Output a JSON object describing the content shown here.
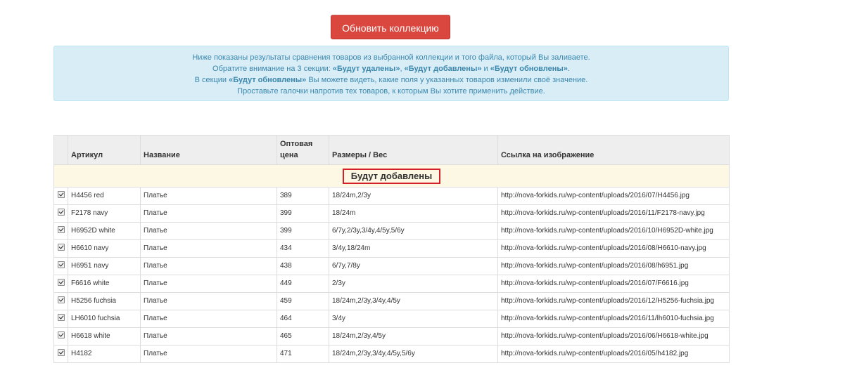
{
  "update_button": {
    "label": "Обновить коллекцию"
  },
  "info": {
    "line1": "Ниже показаны результаты сравнения товаров из выбранной коллекции и того файла, который Вы заливаете.",
    "line2_prefix": "Обратите внимание на 3 секции: ",
    "line2_s1": "«Будут удалены»",
    "line2_sep1": ", ",
    "line2_s2": "«Будут добавлены»",
    "line2_sep2": " и ",
    "line2_s3": "«Будут обновлены»",
    "line2_suffix": ".",
    "line3_prefix": "В секции ",
    "line3_bold": "«Будут обновлены»",
    "line3_suffix": " Вы можете видеть, какие поля у указанных товаров изменили своё значение.",
    "line4": "Проставьте галочки напротив тех товаров, к которым Вы хотите применить действие."
  },
  "table": {
    "headers": [
      "",
      "Артикул",
      "Название",
      "Оптовая цена",
      "Размеры / Вес",
      "Ссылка на изображение"
    ],
    "section_label": "Будут добавлены",
    "rows": [
      {
        "checked": true,
        "sku": "H4456 red",
        "name": "Платье",
        "price": "389",
        "sizes": "18/24m,2/3y",
        "url": "http://nova-forkids.ru/wp-content/uploads/2016/07/H4456.jpg"
      },
      {
        "checked": true,
        "sku": "F2178 navy",
        "name": "Платье",
        "price": "399",
        "sizes": "18/24m",
        "url": "http://nova-forkids.ru/wp-content/uploads/2016/11/F2178-navy.jpg"
      },
      {
        "checked": true,
        "sku": "H6952D white",
        "name": "Платье",
        "price": "399",
        "sizes": "6/7y,2/3y,3/4y,4/5y,5/6y",
        "url": "http://nova-forkids.ru/wp-content/uploads/2016/10/H6952D-white.jpg"
      },
      {
        "checked": true,
        "sku": "H6610 navy",
        "name": "Платье",
        "price": "434",
        "sizes": "3/4y,18/24m",
        "url": "http://nova-forkids.ru/wp-content/uploads/2016/08/H6610-navy.jpg"
      },
      {
        "checked": true,
        "sku": "H6951 navy",
        "name": "Платье",
        "price": "438",
        "sizes": "6/7y,7/8y",
        "url": "http://nova-forkids.ru/wp-content/uploads/2016/08/h6951.jpg"
      },
      {
        "checked": true,
        "sku": "F6616 white",
        "name": "Платье",
        "price": "449",
        "sizes": "2/3y",
        "url": "http://nova-forkids.ru/wp-content/uploads/2016/07/F6616.jpg"
      },
      {
        "checked": true,
        "sku": "H5256 fuchsia",
        "name": "Платье",
        "price": "459",
        "sizes": "18/24m,2/3y,3/4y,4/5y",
        "url": "http://nova-forkids.ru/wp-content/uploads/2016/12/H5256-fuchsia.jpg"
      },
      {
        "checked": true,
        "sku": "LH6010 fuchsia",
        "name": "Платье",
        "price": "464",
        "sizes": "3/4y",
        "url": "http://nova-forkids.ru/wp-content/uploads/2016/11/lh6010-fuchsia.jpg"
      },
      {
        "checked": true,
        "sku": "H6618 white",
        "name": "Платье",
        "price": "465",
        "sizes": "18/24m,2/3y,4/5y",
        "url": "http://nova-forkids.ru/wp-content/uploads/2016/06/H6618-white.jpg"
      },
      {
        "checked": true,
        "sku": "H4182",
        "name": "Платье",
        "price": "471",
        "sizes": "18/24m,2/3y,3/4y,4/5y,5/6y",
        "url": "http://nova-forkids.ru/wp-content/uploads/2016/05/h4182.jpg"
      }
    ]
  },
  "colors": {
    "button": "#d9473f",
    "info_bg": "#d9edf7",
    "info_text": "#3a87ad",
    "section_bg": "#fcf8e3",
    "section_border": "#d41f26"
  }
}
